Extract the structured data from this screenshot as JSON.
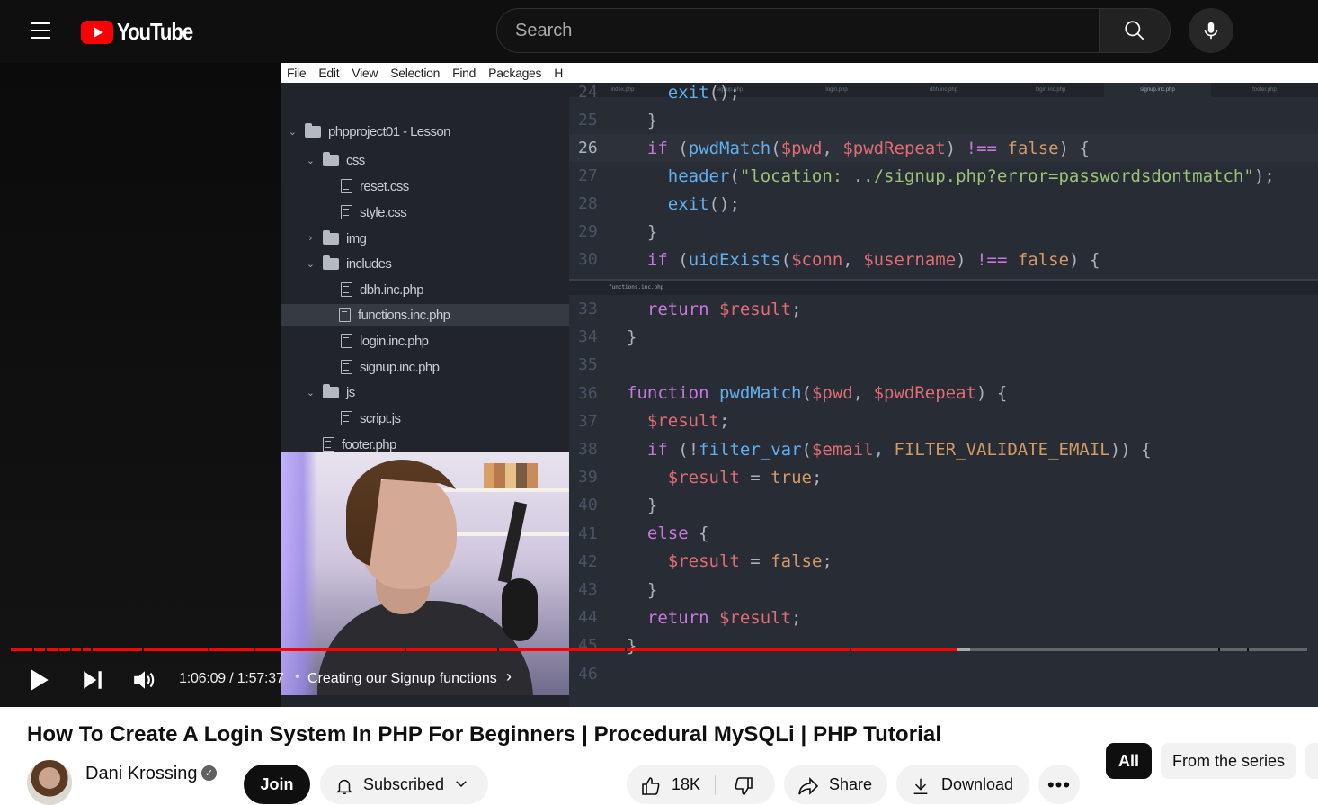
{
  "masthead": {
    "logo_text": "YouTube",
    "search_placeholder": "Search",
    "icons": [
      "menu-icon",
      "youtube-logo",
      "search-icon",
      "mic-icon"
    ]
  },
  "editor": {
    "menu": [
      "File",
      "Edit",
      "View",
      "Selection",
      "Find",
      "Packages",
      "H"
    ],
    "tree": [
      {
        "label": "phpproject01 - Lesson",
        "type": "folder",
        "open": true
      },
      {
        "label": "css",
        "type": "folder",
        "open": true
      },
      {
        "label": "reset.css",
        "type": "file"
      },
      {
        "label": "style.css",
        "type": "file"
      },
      {
        "label": "img",
        "type": "folder",
        "open": false
      },
      {
        "label": "includes",
        "type": "folder",
        "open": true
      },
      {
        "label": "dbh.inc.php",
        "type": "file"
      },
      {
        "label": "functions.inc.php",
        "type": "file",
        "selected": true
      },
      {
        "label": "login.inc.php",
        "type": "file"
      },
      {
        "label": "signup.inc.php",
        "type": "file"
      },
      {
        "label": "js",
        "type": "folder",
        "open": true
      },
      {
        "label": "script.js",
        "type": "file"
      },
      {
        "label": "footer.php",
        "type": "file"
      }
    ],
    "tabs": [
      "index.php",
      "signup.php",
      "login.php",
      "dbh.inc.php",
      "login.inc.php",
      "signup.inc.php",
      "footer.php"
    ],
    "active_tab": "signup.inc.php",
    "split_tab": "functions.inc.php",
    "upper_lines": [
      {
        "n": "24",
        "code": "    exit();"
      },
      {
        "n": "25",
        "code": "  }"
      },
      {
        "n": "26",
        "code": "  if (pwdMatch($pwd, $pwdRepeat) !== false) {"
      },
      {
        "n": "27",
        "code": "    header(\"location: ../signup.php?error=passwordsdontmatch\");"
      },
      {
        "n": "28",
        "code": "    exit();"
      },
      {
        "n": "29",
        "code": "  }"
      },
      {
        "n": "30",
        "code": "  if (uidExists($conn, $username) !== false) {"
      }
    ],
    "lower_lines": [
      {
        "n": "33",
        "code": "  return $result;"
      },
      {
        "n": "34",
        "code": "}"
      },
      {
        "n": "35",
        "code": ""
      },
      {
        "n": "36",
        "code": "function pwdMatch($pwd, $pwdRepeat) {"
      },
      {
        "n": "37",
        "code": "  $result;"
      },
      {
        "n": "38",
        "code": "  if (!filter_var($email, FILTER_VALIDATE_EMAIL)) {"
      },
      {
        "n": "39",
        "code": "    $result = true;"
      },
      {
        "n": "40",
        "code": "  }"
      },
      {
        "n": "41",
        "code": "  else {"
      },
      {
        "n": "42",
        "code": "    $result = false;"
      },
      {
        "n": "43",
        "code": "  }"
      },
      {
        "n": "44",
        "code": "  return $result;"
      },
      {
        "n": "45",
        "code": "}"
      },
      {
        "n": "46",
        "code": ""
      }
    ]
  },
  "player": {
    "current_time": "1:06:09",
    "duration": "1:57:37",
    "time_display": "1:06:09 / 1:57:37",
    "chapter": "Creating our Signup functions",
    "progress_fraction": 0.73,
    "buffered_fraction": 0.74,
    "accent_color": "#ff0000",
    "icons": [
      "play-icon",
      "next-icon",
      "volume-icon",
      "chevron-right-icon"
    ]
  },
  "video": {
    "title": "How To Create A Login System In PHP For Beginners | Procedural MySQLi | PHP Tutorial",
    "channel": "Dani Krossing",
    "join_label": "Join",
    "subscribed_label": "Subscribed",
    "likes": "18K",
    "share_label": "Share",
    "download_label": "Download"
  },
  "chips": {
    "all": "All",
    "series": "From the series"
  }
}
